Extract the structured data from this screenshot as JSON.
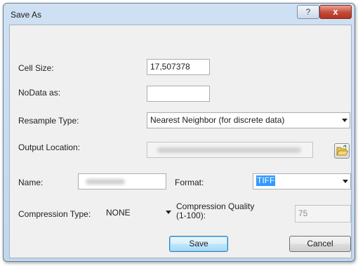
{
  "window": {
    "title": "Save As",
    "help_label": "?",
    "close_label": "x"
  },
  "form": {
    "cell_size": {
      "label": "Cell Size:",
      "value": "17,507378"
    },
    "nodata": {
      "label": "NoData as:",
      "value": ""
    },
    "resample": {
      "label": "Resample Type:",
      "value": "Nearest Neighbor (for discrete data)"
    },
    "output": {
      "label": "Output Location:",
      "button_icon": "folder-open-icon"
    },
    "name": {
      "label": "Name:"
    },
    "format": {
      "label": "Format:",
      "value": "TIFF"
    },
    "compression": {
      "label": "Compression Type:",
      "value": "NONE"
    },
    "quality": {
      "label_line1": "Compression Quality",
      "label_line2": "(1-100):",
      "value": "75"
    }
  },
  "buttons": {
    "save": "Save",
    "cancel": "Cancel"
  },
  "colors": {
    "selection": "#3399ff",
    "close_button": "#c44a38",
    "default_button_border": "#3c7fb1"
  }
}
